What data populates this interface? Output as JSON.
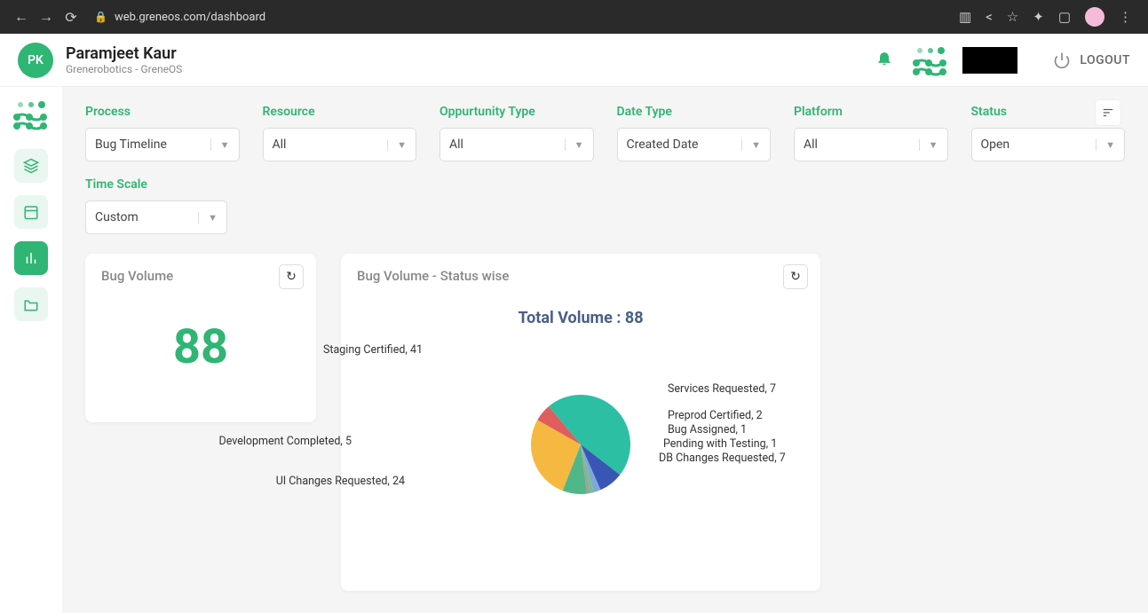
{
  "browser": {
    "url": "web.greneos.com/dashboard"
  },
  "header": {
    "user_initials": "PK",
    "user_name": "Paramjeet Kaur",
    "user_org": "Grenerobotics - GreneOS",
    "logout": "LOGOUT"
  },
  "filters": {
    "process": {
      "label": "Process",
      "value": "Bug Timeline"
    },
    "resource": {
      "label": "Resource",
      "value": "All"
    },
    "opportunity_type": {
      "label": "Oppurtunity Type",
      "value": "All"
    },
    "date_type": {
      "label": "Date Type",
      "value": "Created Date"
    },
    "platform": {
      "label": "Platform",
      "value": "All"
    },
    "status": {
      "label": "Status",
      "value": "Open"
    },
    "timescale": {
      "label": "Time Scale",
      "value": "Custom"
    }
  },
  "cards": {
    "volume": {
      "title": "Bug Volume",
      "value": "88"
    },
    "status_wise": {
      "title": "Bug Volume - Status wise",
      "total_label": "Total Volume : 88",
      "slices": [
        {
          "name": "Staging Certified",
          "value": 41,
          "color": "#2cbfa3"
        },
        {
          "name": "Services Requested",
          "value": 7,
          "color": "#3a56b5"
        },
        {
          "name": "Preprod Certified",
          "value": 2,
          "color": "#7fa8d9"
        },
        {
          "name": "Bug Assigned",
          "value": 1,
          "color": "#6fc28c"
        },
        {
          "name": "Pending with Testing",
          "value": 1,
          "color": "#a0a0a0"
        },
        {
          "name": "DB Changes Requested",
          "value": 7,
          "color": "#52b788"
        },
        {
          "name": "UI Changes Requested",
          "value": 24,
          "color": "#f5b942"
        },
        {
          "name": "Development Completed",
          "value": 5,
          "color": "#e05d5d"
        }
      ]
    }
  },
  "chart_data": {
    "type": "pie",
    "title": "Bug Volume - Status wise",
    "total": 88,
    "series": [
      {
        "name": "Staging Certified",
        "value": 41
      },
      {
        "name": "Services Requested",
        "value": 7
      },
      {
        "name": "Preprod Certified",
        "value": 2
      },
      {
        "name": "Bug Assigned",
        "value": 1
      },
      {
        "name": "Pending with Testing",
        "value": 1
      },
      {
        "name": "DB Changes Requested",
        "value": 7
      },
      {
        "name": "UI Changes Requested",
        "value": 24
      },
      {
        "name": "Development Completed",
        "value": 5
      }
    ]
  }
}
